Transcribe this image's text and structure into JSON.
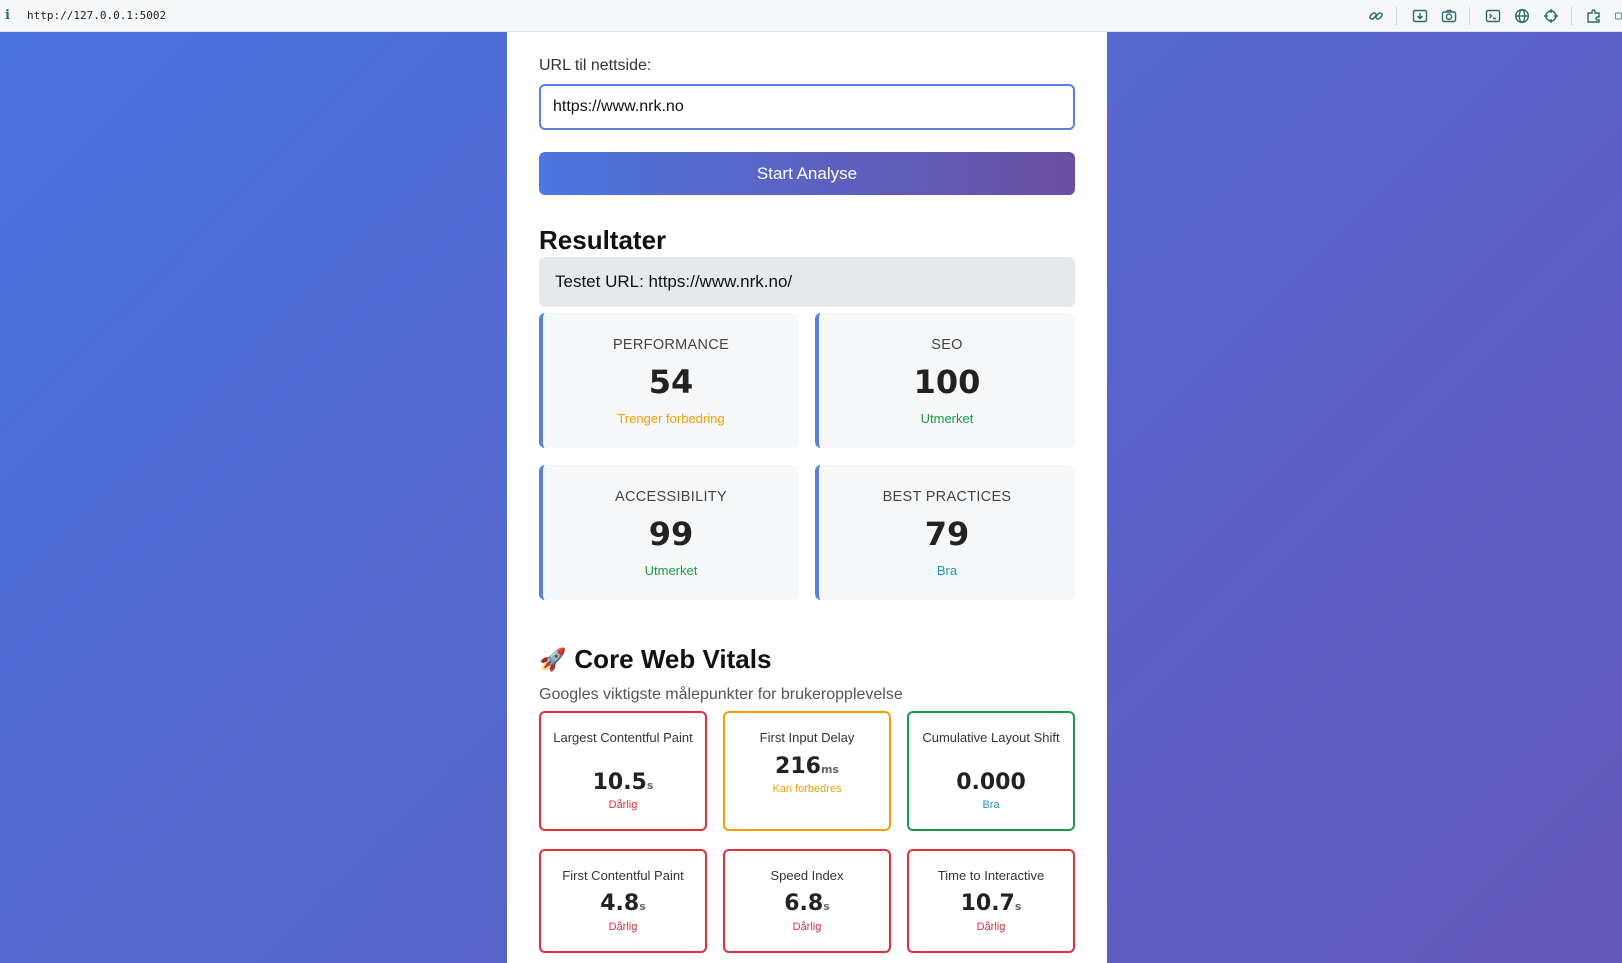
{
  "browser": {
    "info_icon": "i",
    "url": "http://127.0.0.1:5002",
    "toolbar_icons": [
      "link-icon",
      "download-icon",
      "camera-icon",
      "terminal-icon",
      "globe-icon",
      "crosshair-icon",
      "extension-icon"
    ]
  },
  "form": {
    "label": "URL til nettside:",
    "url_value": "https://www.nrk.no",
    "button": "Start Analyse"
  },
  "results": {
    "title": "Resultater",
    "tested_url": "Testet URL: https://www.nrk.no/",
    "scores": [
      {
        "label": "PERFORMANCE",
        "value": "54",
        "status": "Trenger forbedring",
        "status_color": "#f0a000"
      },
      {
        "label": "SEO",
        "value": "100",
        "status": "Utmerket",
        "status_color": "#1a9a48"
      },
      {
        "label": "ACCESSIBILITY",
        "value": "99",
        "status": "Utmerket",
        "status_color": "#1a9a48"
      },
      {
        "label": "BEST PRACTICES",
        "value": "79",
        "status": "Bra",
        "status_color": "#1f93b8"
      }
    ]
  },
  "core_web_vitals": {
    "emoji": "🚀",
    "title": "Core Web Vitals",
    "subtitle": "Googles viktigste målepunkter for brukeropplevelse",
    "metrics": [
      {
        "name": "Largest Contentful Paint",
        "value": "10.5",
        "unit": "s",
        "status": "Dårlig",
        "color": "#e02e3c"
      },
      {
        "name": "First Input Delay",
        "value": "216",
        "unit": "ms",
        "status": "Kan forbedres",
        "color": "#f0a000"
      },
      {
        "name": "Cumulative Layout Shift",
        "value": "0.000",
        "unit": "",
        "status": "Bra",
        "color": "#1a9a48",
        "status_color": "#1f93b8"
      },
      {
        "name": "First Contentful Paint",
        "value": "4.8",
        "unit": "s",
        "status": "Dårlig",
        "color": "#e02e3c"
      },
      {
        "name": "Speed Index",
        "value": "6.8",
        "unit": "s",
        "status": "Dårlig",
        "color": "#e02e3c"
      },
      {
        "name": "Time to Interactive",
        "value": "10.7",
        "unit": "s",
        "status": "Dårlig",
        "color": "#e02e3c"
      }
    ]
  }
}
